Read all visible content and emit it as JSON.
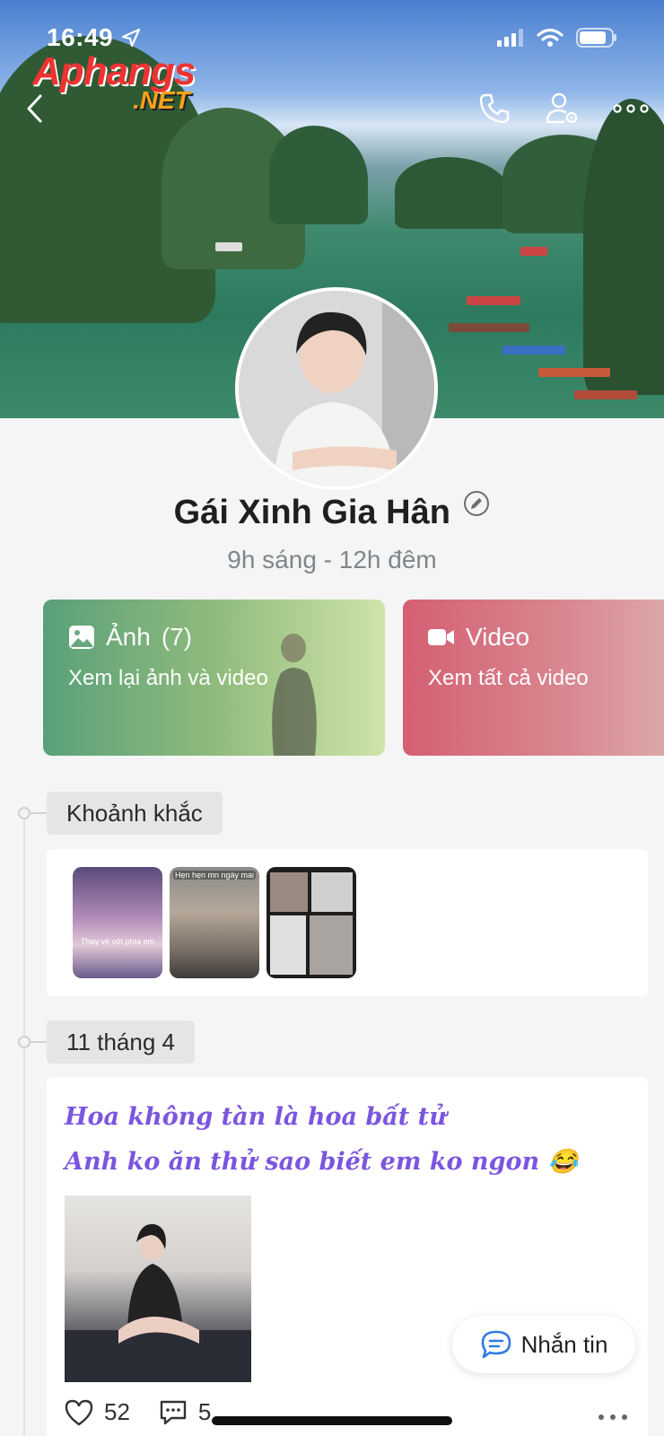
{
  "status_bar": {
    "time": "16:49"
  },
  "watermark": {
    "line1": "Aphangs",
    "line2": ".NET"
  },
  "header": {
    "icons": [
      "back-icon",
      "phone-icon",
      "user-settings-icon",
      "more-icon"
    ]
  },
  "profile": {
    "name": "Gái Xinh Gia Hân",
    "hours": "9h sáng - 12h đêm"
  },
  "media_cards": {
    "photos": {
      "label": "Ảnh",
      "count": "(7)",
      "subtitle": "Xem lại ảnh và video"
    },
    "videos": {
      "label": "Video",
      "subtitle": "Xem tất cả video"
    }
  },
  "timeline": {
    "moments_label": "Khoảnh khắc",
    "moments": [
      {
        "caption": "Thay vẻ với phía em"
      },
      {
        "caption": "Hẹn hẹn mn ngày mai"
      },
      {
        "caption": ""
      }
    ],
    "date_label": "11 tháng 4"
  },
  "post": {
    "line1": "Hoa không tàn là hoa bất tử",
    "line2": "Anh ko ăn thử sao biết em ko ngon 😂",
    "likes": "52",
    "comments": "5"
  },
  "message_button": {
    "label": "Nhắn tin"
  },
  "colors": {
    "photos_card": "#5aa07a",
    "videos_card": "#d45f72",
    "post_text": "#7b55e0",
    "message_icon": "#2f7ae5"
  }
}
